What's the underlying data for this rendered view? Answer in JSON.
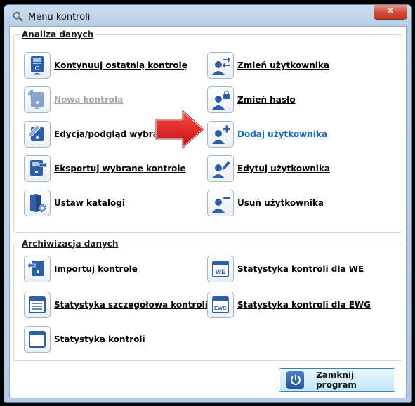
{
  "window": {
    "title": "Menu kontroli",
    "close_glyph": "✕"
  },
  "colors": {
    "link": "#1664c0",
    "disabled": "#a8a8a8",
    "icon_blue": "#2e5ea8",
    "arrow_red": "#d81b1b"
  },
  "group_analysis": {
    "title": "Analiza danych",
    "left_items": [
      {
        "label": "Kontynuuj ostatnią kontrolę",
        "icon": "document-user-icon",
        "state": "normal"
      },
      {
        "label": "Nowa kontrola",
        "icon": "new-document-icon",
        "state": "disabled"
      },
      {
        "label": "Edycja/podgląd wybranej",
        "icon": "edit-document-icon",
        "state": "normal"
      },
      {
        "label": "Eksportuj wybrane kontrole",
        "icon": "export-document-icon",
        "state": "normal"
      },
      {
        "label": "Ustaw katalogi",
        "icon": "folder-settings-icon",
        "state": "normal"
      }
    ],
    "right_items": [
      {
        "label": "Zmień użytkownika",
        "icon": "switch-user-icon",
        "state": "normal"
      },
      {
        "label": "Zmień hasło",
        "icon": "user-lock-icon",
        "state": "normal"
      },
      {
        "label": "Dodaj użytkownika",
        "icon": "add-user-icon",
        "state": "link"
      },
      {
        "label": "Edytuj użytkownika",
        "icon": "edit-user-icon",
        "state": "normal"
      },
      {
        "label": "Usuń użytkownika",
        "icon": "remove-user-icon",
        "state": "normal"
      }
    ]
  },
  "group_archive": {
    "title": "Archiwizacja danych",
    "left_items": [
      {
        "label": "Importuj kontrole",
        "icon": "import-document-icon",
        "state": "normal"
      },
      {
        "label": "Statystyka szczegółowa kontroli",
        "icon": "detailed-stats-icon",
        "state": "normal"
      },
      {
        "label": "Statystyka kontroli",
        "icon": "stats-window-icon",
        "state": "normal"
      }
    ],
    "right_items": [
      {
        "label": "Statystyka kontroli dla WE",
        "icon": "we-stats-icon",
        "icon_text": "WE",
        "state": "normal"
      },
      {
        "label": "Statystyka kontroli dla EWG",
        "icon": "ewg-stats-icon",
        "icon_text": "EWG",
        "state": "normal"
      }
    ]
  },
  "exit_button": {
    "label": "Zamknij program",
    "icon": "power-icon"
  }
}
